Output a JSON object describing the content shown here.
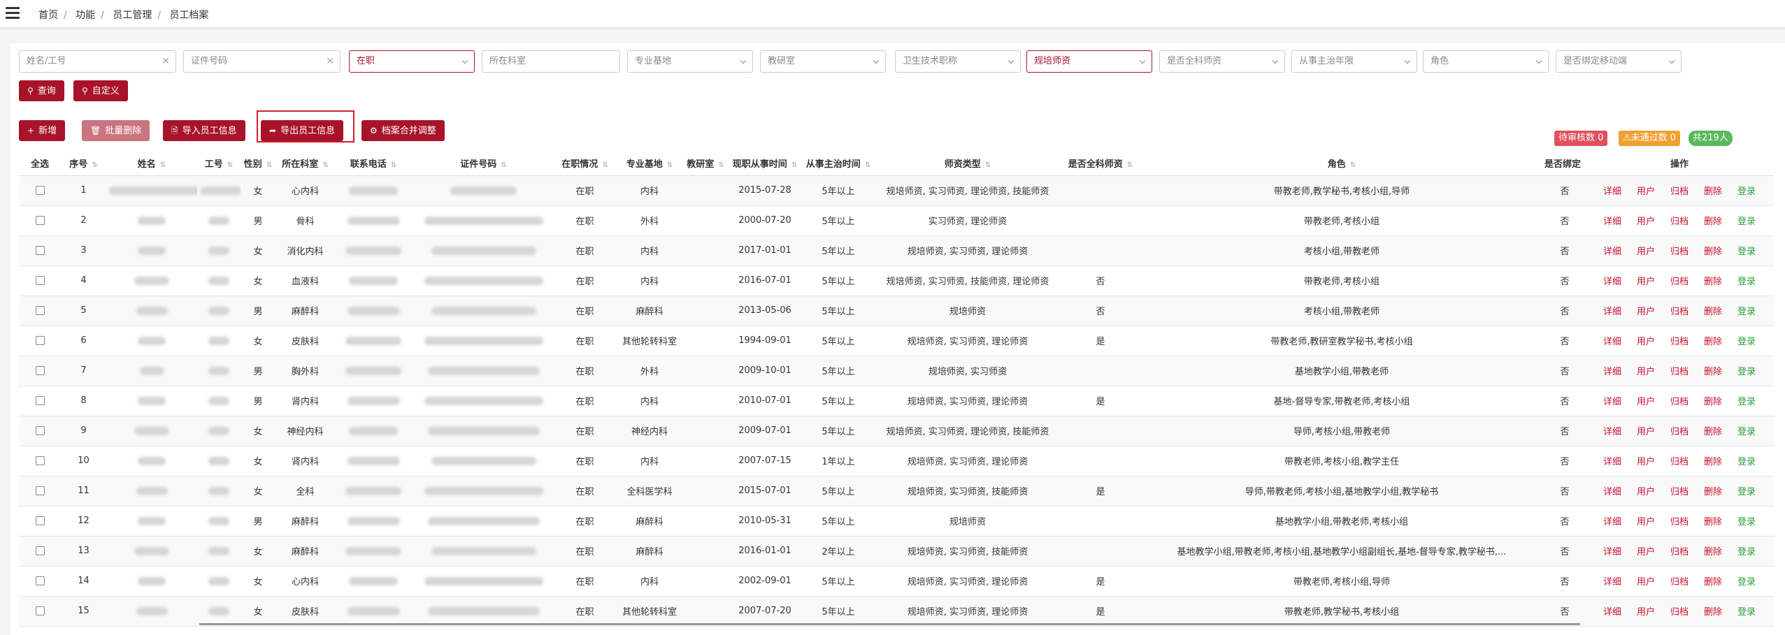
{
  "breadcrumb": [
    "首页",
    "功能",
    "员工管理",
    "员工档案"
  ],
  "filters": {
    "name_placeholder": "姓名/工号",
    "id_placeholder": "证件号码",
    "status": "在职",
    "dept_placeholder": "所在科室",
    "base_placeholder": "专业基地",
    "teaching_room": "教研室",
    "tech_title": "卫生技术职称",
    "teacher_type": "规培师资",
    "general_teacher": "是否全科师资",
    "years": "从事主治年限",
    "role": "角色",
    "bind_mobile": "是否绑定移动端"
  },
  "actions": {
    "query": "查询",
    "custom": "自定义"
  },
  "toolbar": {
    "add": "新增",
    "batch_delete": "批量删除",
    "import": "导入员工信息",
    "export": "导出员工信息",
    "merge": "档案合并调整"
  },
  "badges": {
    "pending": "待审核数 0",
    "rejected": "未通过数 0",
    "total": "共219人"
  },
  "colors": {
    "primary": "#a8132a",
    "pending": "#e0505a",
    "rejected": "#f0a030",
    "total": "#5cb85c"
  },
  "table": {
    "headers": [
      "全选",
      "序号",
      "姓名",
      "工号",
      "性别",
      "所在科室",
      "联系电话",
      "证件号码",
      "在职情况",
      "专业基地",
      "教研室",
      "现职从事时间",
      "从事主治时间",
      "师资类型",
      "是否全科师资",
      "角色",
      "是否绑定",
      "操作"
    ],
    "ops": [
      "详细",
      "用户",
      "归档",
      "删除",
      "登录"
    ],
    "rows": [
      {
        "no": "1",
        "gender": "女",
        "dept": "心内科",
        "status": "在职",
        "base": "内科",
        "start": "2015-07-28",
        "years": "5年以上",
        "type": "规培师资, 实习师资, 理论师资, 技能师资",
        "general": "",
        "role": "带教老师,教学秘书,考核小组,导师",
        "bind": "否"
      },
      {
        "no": "2",
        "gender": "男",
        "dept": "骨科",
        "status": "在职",
        "base": "外科",
        "start": "2000-07-20",
        "years": "5年以上",
        "type": "实习师资, 理论师资",
        "general": "",
        "role": "带教老师,考核小组",
        "bind": "否"
      },
      {
        "no": "3",
        "gender": "女",
        "dept": "消化内科",
        "status": "在职",
        "base": "内科",
        "start": "2017-01-01",
        "years": "5年以上",
        "type": "规培师资, 实习师资, 理论师资",
        "general": "",
        "role": "考核小组,带教老师",
        "bind": "否"
      },
      {
        "no": "4",
        "gender": "女",
        "dept": "血液科",
        "status": "在职",
        "base": "内科",
        "start": "2016-07-01",
        "years": "5年以上",
        "type": "规培师资, 实习师资, 技能师资, 理论师资",
        "general": "否",
        "role": "带教老师,考核小组",
        "bind": "否"
      },
      {
        "no": "5",
        "gender": "男",
        "dept": "麻醉科",
        "status": "在职",
        "base": "麻醉科",
        "start": "2013-05-06",
        "years": "5年以上",
        "type": "规培师资",
        "general": "否",
        "role": "考核小组,带教老师",
        "bind": "否"
      },
      {
        "no": "6",
        "gender": "女",
        "dept": "皮肤科",
        "status": "在职",
        "base": "其他轮转科室",
        "start": "1994-09-01",
        "years": "5年以上",
        "type": "规培师资, 实习师资, 理论师资",
        "general": "是",
        "role": "带教老师,教研室教学秘书,考核小组",
        "bind": "否"
      },
      {
        "no": "7",
        "gender": "男",
        "dept": "胸外科",
        "status": "在职",
        "base": "外科",
        "start": "2009-10-01",
        "years": "5年以上",
        "type": "规培师资, 实习师资",
        "general": "",
        "role": "基地教学小组,带教老师",
        "bind": "否"
      },
      {
        "no": "8",
        "gender": "男",
        "dept": "肾内科",
        "status": "在职",
        "base": "内科",
        "start": "2010-07-01",
        "years": "5年以上",
        "type": "规培师资, 实习师资, 理论师资",
        "general": "是",
        "role": "基地-督导专家,带教老师,考核小组",
        "bind": "否"
      },
      {
        "no": "9",
        "gender": "女",
        "dept": "神经内科",
        "status": "在职",
        "base": "神经内科",
        "start": "2009-07-01",
        "years": "5年以上",
        "type": "规培师资, 实习师资, 理论师资, 技能师资",
        "general": "",
        "role": "导师,考核小组,带教老师",
        "bind": "否"
      },
      {
        "no": "10",
        "gender": "女",
        "dept": "肾内科",
        "status": "在职",
        "base": "内科",
        "start": "2007-07-15",
        "years": "1年以上",
        "type": "规培师资, 实习师资, 理论师资",
        "general": "",
        "role": "带教老师,考核小组,教学主任",
        "bind": "否"
      },
      {
        "no": "11",
        "gender": "女",
        "dept": "全科",
        "status": "在职",
        "base": "全科医学科",
        "start": "2015-07-01",
        "years": "5年以上",
        "type": "规培师资, 实习师资, 技能师资",
        "general": "是",
        "role": "导师,带教老师,考核小组,基地教学小组,教学秘书",
        "bind": "否"
      },
      {
        "no": "12",
        "gender": "男",
        "dept": "麻醉科",
        "status": "在职",
        "base": "麻醉科",
        "start": "2010-05-31",
        "years": "5年以上",
        "type": "规培师资",
        "general": "",
        "role": "基地教学小组,带教老师,考核小组",
        "bind": "否"
      },
      {
        "no": "13",
        "gender": "女",
        "dept": "麻醉科",
        "status": "在职",
        "base": "麻醉科",
        "start": "2016-01-01",
        "years": "2年以上",
        "type": "规培师资, 实习师资, 技能师资",
        "general": "",
        "role": "基地教学小组,带教老师,考核小组,基地教学小组副组长,基地-督导专家,教学秘书,...",
        "bind": "否"
      },
      {
        "no": "14",
        "gender": "女",
        "dept": "心内科",
        "status": "在职",
        "base": "内科",
        "start": "2002-09-01",
        "years": "5年以上",
        "type": "规培师资, 实习师资, 理论师资",
        "general": "是",
        "role": "带教老师,考核小组,导师",
        "bind": "否"
      },
      {
        "no": "15",
        "gender": "女",
        "dept": "皮肤科",
        "status": "在职",
        "base": "其他轮转科室",
        "start": "2007-07-20",
        "years": "5年以上",
        "type": "规培师资, 实习师资, 理论师资",
        "general": "是",
        "role": "带教老师,教学秘书,考核小组",
        "bind": "否"
      }
    ]
  }
}
